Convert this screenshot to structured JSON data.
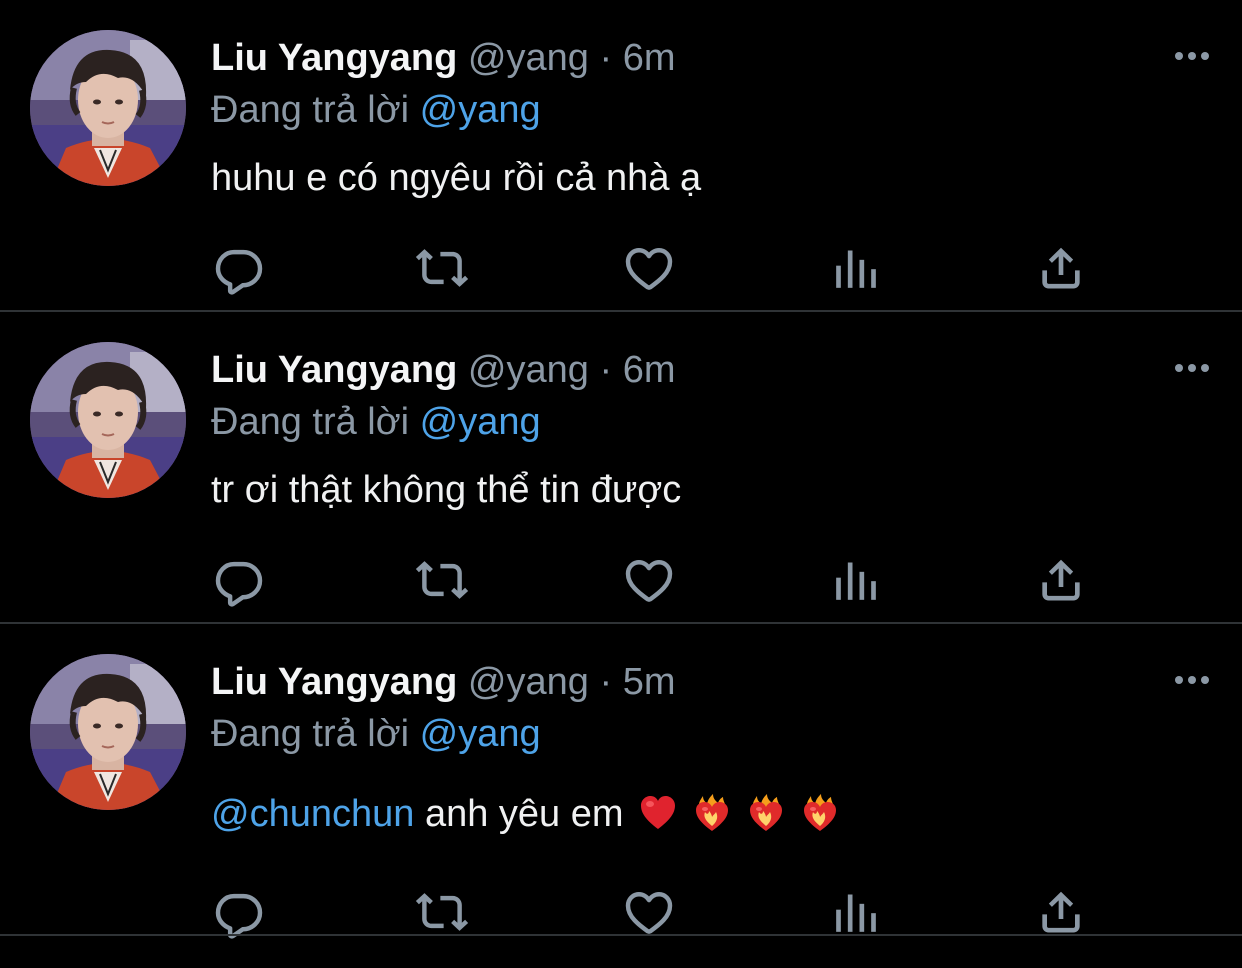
{
  "tweets": [
    {
      "display_name": "Liu Yangyang",
      "handle": "@yang",
      "separator": "·",
      "time": "6m",
      "reply_label": "Đang trả lời",
      "reply_to": "@yang",
      "body": "huhu e có ngyêu rồi cả nhà ạ"
    },
    {
      "display_name": "Liu Yangyang",
      "handle": "@yang",
      "separator": "·",
      "time": "6m",
      "reply_label": "Đang trả lời",
      "reply_to": "@yang",
      "body": "tr ơi thật không thể tin được"
    },
    {
      "display_name": "Liu Yangyang",
      "handle": "@yang",
      "separator": "·",
      "time": "5m",
      "reply_label": "Đang trả lời",
      "reply_to": "@yang",
      "body_mention": "@chunchun",
      "body": " anh yêu em",
      "emojis": [
        "red-heart",
        "heart-on-fire",
        "heart-on-fire",
        "heart-on-fire"
      ]
    }
  ],
  "colors": {
    "background": "#000000",
    "text_primary": "#f4f5f6",
    "text_secondary": "#8b98a5",
    "accent_link": "#4ea3e8",
    "divider": "#2f3336"
  },
  "icons": {
    "reply": "reply-icon",
    "retweet": "retweet-icon",
    "like": "like-icon",
    "analytics": "analytics-icon",
    "share": "share-icon",
    "more": "more-icon"
  }
}
